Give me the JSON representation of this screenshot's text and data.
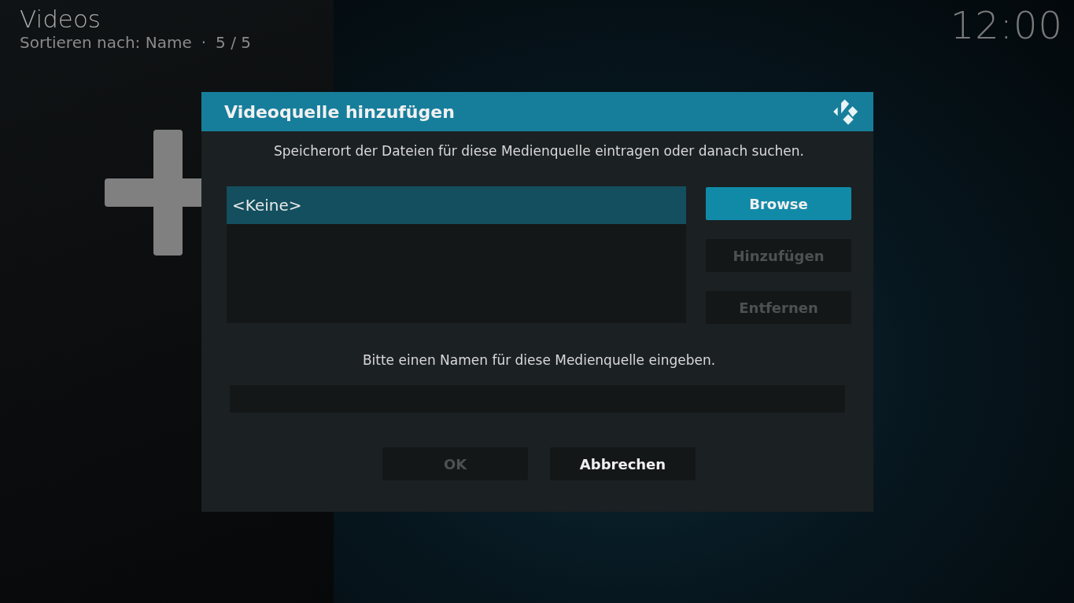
{
  "header": {
    "title": "Videos",
    "sort_label": "Sortieren nach: Name",
    "separator": "·",
    "count": "5 / 5"
  },
  "clock": "12:00",
  "dialog": {
    "title": "Videoquelle hinzufügen",
    "path_prompt": "Speicherort der Dateien für diese Medienquelle eintragen oder danach suchen.",
    "paths": [
      {
        "label": "<Keine>",
        "selected": true
      }
    ],
    "side_buttons": [
      {
        "label": "Browse",
        "focused": true,
        "disabled": false
      },
      {
        "label": "Hinzufügen",
        "focused": false,
        "disabled": true
      },
      {
        "label": "Entfernen",
        "focused": false,
        "disabled": true
      }
    ],
    "name_prompt": "Bitte einen Namen für diese Medienquelle eingeben.",
    "buttons": [
      {
        "label": "OK",
        "focused": false,
        "disabled": true
      },
      {
        "label": "Abbrechen",
        "focused": false,
        "disabled": false
      }
    ]
  }
}
